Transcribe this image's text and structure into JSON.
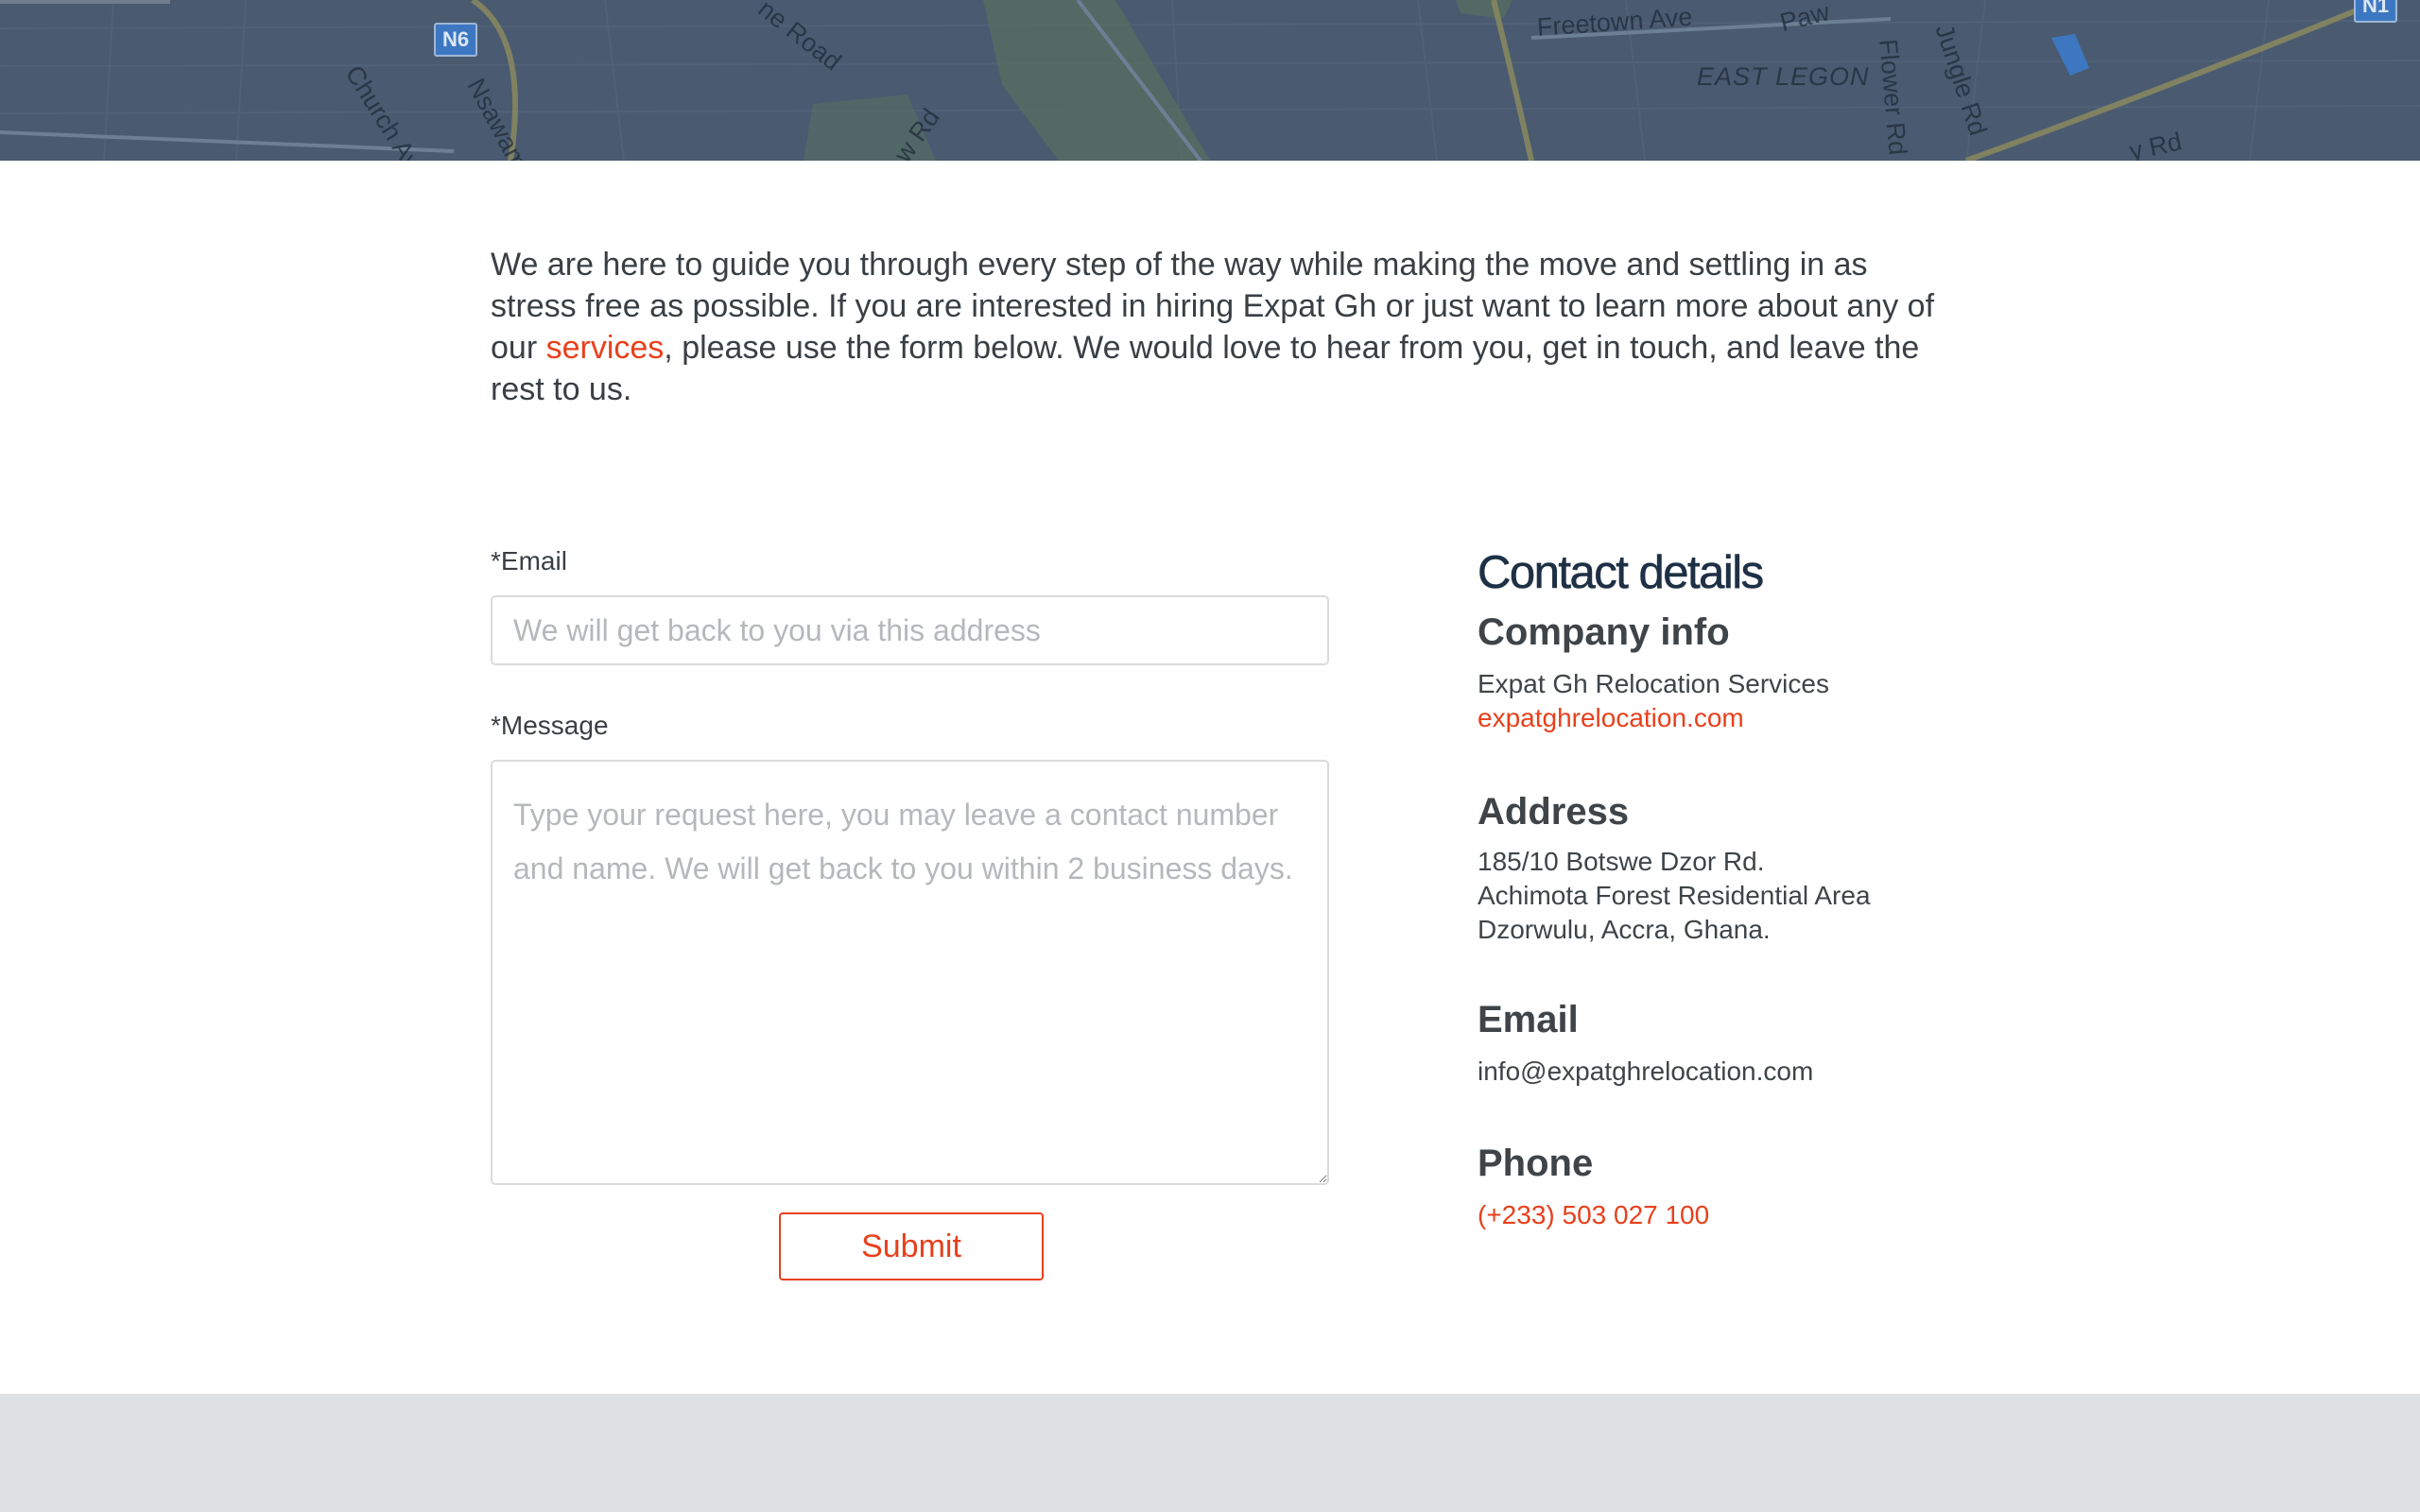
{
  "map": {
    "road_labels": [
      "Church Ave",
      "Nsawam",
      "ne Road",
      "w Rd",
      "Freetown Ave",
      "Paw",
      "Flower Rd",
      "Jungle Rd",
      "y Rd"
    ],
    "area_label": "EAST LEGON",
    "route_shields": [
      "N6",
      "N1"
    ]
  },
  "intro": {
    "text_before": "We are here to guide you through every step of the way while making the move and settling in as stress free as possible. If you are interested in hiring Expat Gh or just want to learn more about any of our ",
    "link_text": "services",
    "text_after": ", please use the form below. We would love to hear from you, get in touch, and leave the rest to us."
  },
  "form": {
    "email_label": "*Email",
    "email_value": "",
    "email_placeholder": "We will get back to you via this address",
    "message_label": "*Message",
    "message_value": "",
    "message_placeholder": "Type your request here, you may leave a contact number and name. We will get back to you within 2 business days.",
    "submit_label": "Submit"
  },
  "contact": {
    "title": "Contact details",
    "company_heading": "Company info",
    "company_name": "Expat Gh Relocation Services",
    "company_site": "expatghrelocation.com",
    "address_heading": "Address",
    "address_lines": [
      "185/10 Botswe Dzor Rd.",
      "Achimota Forest Residential Area",
      "Dzorwulu, Accra, Ghana."
    ],
    "email_heading": "Email",
    "email": "info@expatghrelocation.com",
    "phone_heading": "Phone",
    "phone": "(+233) 503 027 100"
  },
  "colors": {
    "accent": "#e8401c",
    "heading": "#1e3045",
    "text": "#3f4448",
    "map_overlay": "#4a5a70",
    "footer": "#dfe2e5"
  }
}
